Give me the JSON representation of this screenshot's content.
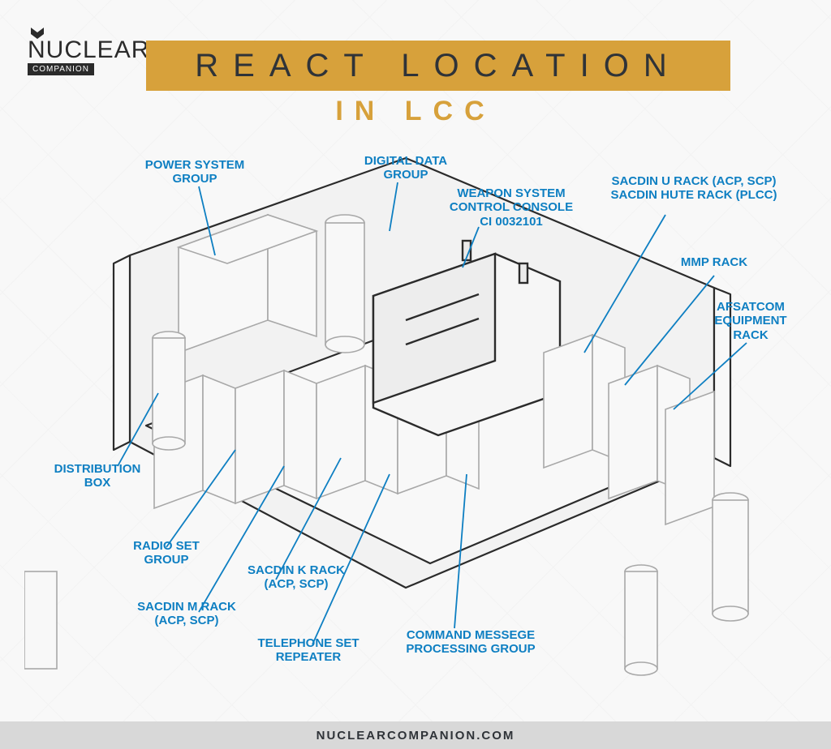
{
  "logo": {
    "line1": "NUCLEAR",
    "line2": "COMPANION"
  },
  "title": "REACT LOCATION",
  "subtitle": "IN LCC",
  "footer": "NUCLEARCOMPANION.COM",
  "labels": {
    "power_system_group": "POWER SYSTEM\nGROUP",
    "digital_data_group": "DIGITAL DATA\nGROUP",
    "weapon_console": "WEAPON SYSTEM\nCONTROL CONSOLE\nCI 0032101",
    "sacdin_u_hute": "SACDIN U RACK (ACP, SCP)\nSACDIN HUTE RACK (PLCC)",
    "mmp_rack": "MMP RACK",
    "afsatcom": "AFSATCOM\nEQUIPMENT\nRACK",
    "distribution_box": "DISTRIBUTION\nBOX",
    "radio_set_group": "RADIO SET\nGROUP",
    "sacdin_m_rack": "SACDIN M RACK\n(ACP, SCP)",
    "sacdin_k_rack": "SACDIN K RACK\n(ACP, SCP)",
    "telephone_repeater": "TELEPHONE SET\nREPEATER",
    "command_processing": "COMMAND MESSEGE\nPROCESSING GROUP"
  },
  "colors": {
    "accent": "#d7a13b",
    "label": "#0e7fc2",
    "line_dark": "#2b2b2b",
    "line_light": "#a8a8a8"
  }
}
